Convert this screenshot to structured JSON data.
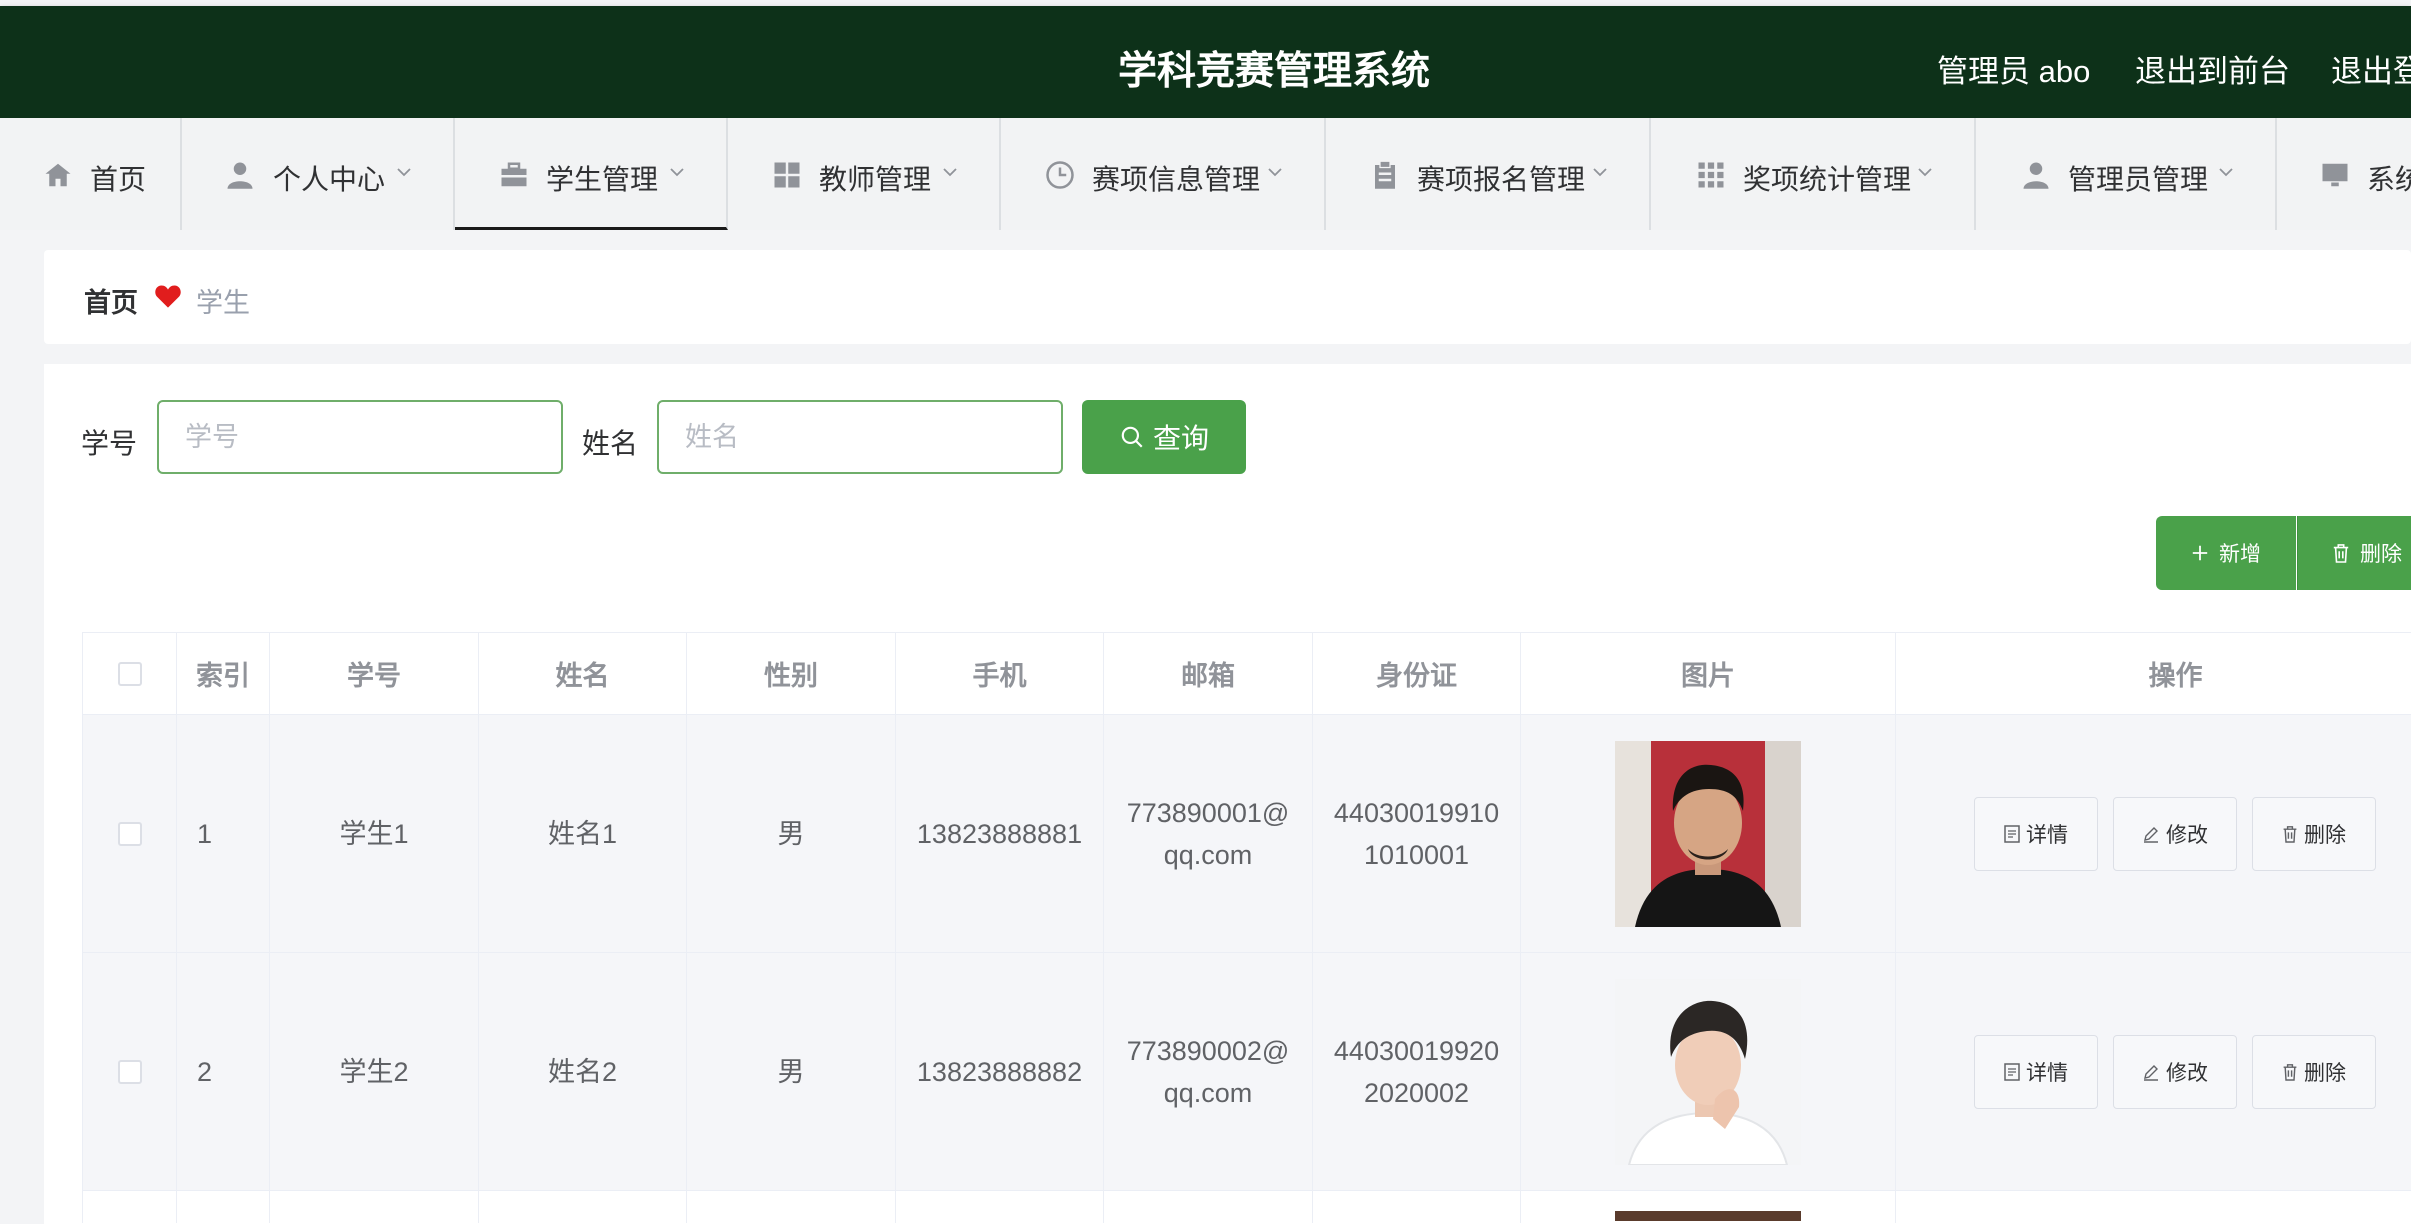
{
  "header": {
    "title": "学科竞赛管理系统",
    "admin_label": "管理员 abo",
    "exit_front": "退出到前台",
    "logout": "退出登"
  },
  "nav": [
    {
      "label": "首页",
      "icon": "home-icon"
    },
    {
      "label": "个人中心",
      "icon": "user-icon"
    },
    {
      "label": "学生管理",
      "icon": "briefcase-icon",
      "active": true
    },
    {
      "label": "教师管理",
      "icon": "grid-icon"
    },
    {
      "label": "赛项信息管理",
      "icon": "clock-icon"
    },
    {
      "label": "赛项报名管理",
      "icon": "clipboard-icon"
    },
    {
      "label": "奖项统计管理",
      "icon": "apps-icon"
    },
    {
      "label": "管理员管理",
      "icon": "user-icon"
    },
    {
      "label": "系统",
      "icon": "monitor-icon"
    }
  ],
  "breadcrumb": {
    "home": "首页",
    "current": "学生"
  },
  "search": {
    "student_no_label": "学号",
    "student_no_placeholder": "学号",
    "name_label": "姓名",
    "name_placeholder": "姓名",
    "query_button": "查询"
  },
  "actions": {
    "add": "新增",
    "delete": "删除"
  },
  "table": {
    "headers": [
      "",
      "索引",
      "学号",
      "姓名",
      "性别",
      "手机",
      "邮箱",
      "身份证",
      "图片",
      "操作"
    ],
    "rows": [
      {
        "index": "1",
        "student_no": "学生1",
        "name": "姓名1",
        "gender": "男",
        "phone": "13823888881",
        "email_1": "773890001@",
        "email_2": "qq.com",
        "id_1": "44030019910",
        "id_2": "1010001"
      },
      {
        "index": "2",
        "student_no": "学生2",
        "name": "姓名2",
        "gender": "男",
        "phone": "13823888882",
        "email_1": "773890002@",
        "email_2": "qq.com",
        "id_1": "44030019920",
        "id_2": "2020002"
      }
    ],
    "op_labels": {
      "detail": "详情",
      "edit": "修改",
      "delete": "删除"
    }
  },
  "colors": {
    "header_bg": "#0d3119",
    "primary_green": "#4aa14a",
    "input_border": "#6fae6a",
    "heart": "#e11d1d"
  }
}
